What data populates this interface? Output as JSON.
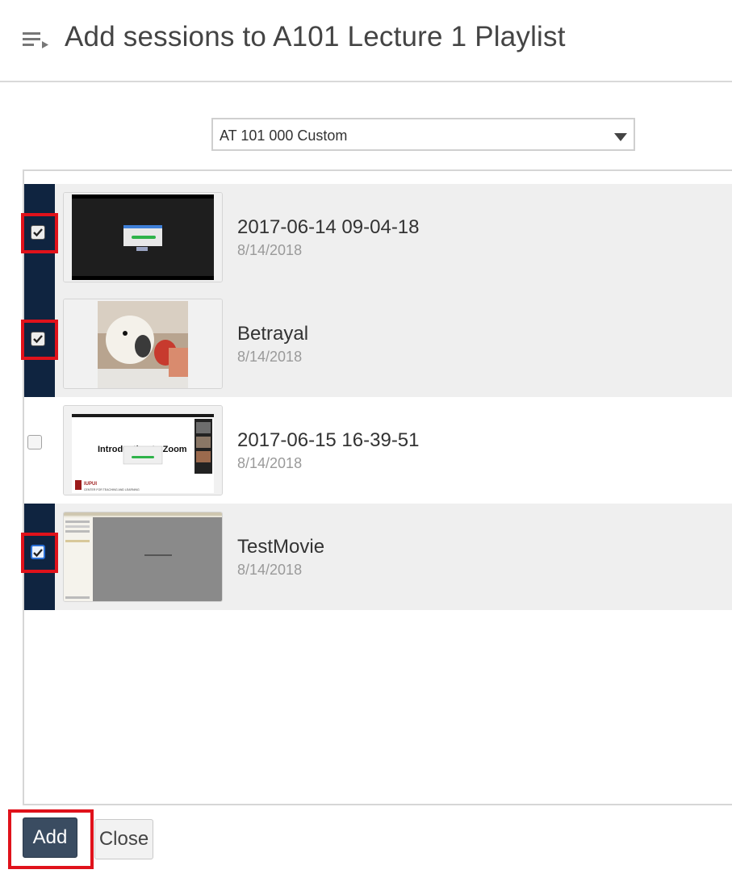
{
  "dialog": {
    "title": "Add sessions to A101 Lecture 1 Playlist",
    "menu_icon": "playlist-add-icon"
  },
  "folder_select": {
    "value": "AT 101 000 Custom",
    "icon": "caret-down-icon"
  },
  "sessions": [
    {
      "name": "2017-06-14 09-04-18",
      "date": "8/14/2018",
      "checked": true
    },
    {
      "name": "Betrayal",
      "date": "8/14/2018",
      "checked": true
    },
    {
      "name": "2017-06-15 16-39-51",
      "date": "8/14/2018",
      "checked": false
    },
    {
      "name": "TestMovie",
      "date": "8/14/2018",
      "checked": true
    }
  ],
  "thumbnail_text": {
    "zoom_title": "Introduction to Zoom",
    "zoom_brand": "IUPUI",
    "zoom_subtitle": "CENTER FOR TEACHING AND LEARNING"
  },
  "buttons": {
    "add": "Add",
    "close": "Close"
  },
  "colors": {
    "selected_bar": "#0f2440",
    "highlight": "#e0121b",
    "add_button": "#3a4c61"
  }
}
